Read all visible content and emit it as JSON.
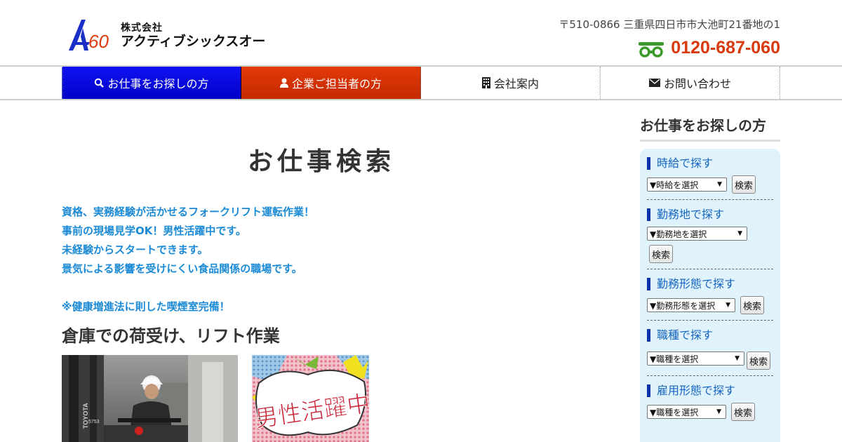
{
  "header": {
    "logo_small": "株式会社",
    "logo_big": "アクティブシックスオー",
    "address": "〒510-0866 三重県四日市市大池町21番地の1",
    "phone": "0120-687-060",
    "phone_icon": "freedial-icon",
    "colors": {
      "phone": "#d83a10",
      "logo_blue": "#1a2fc8",
      "logo_red": "#e03a10"
    }
  },
  "nav": {
    "items": [
      {
        "label": "お仕事をお探しの方",
        "icon": "search-icon",
        "color": "#0000e0"
      },
      {
        "label": "企業ご担当者の方",
        "icon": "user-icon",
        "color": "#d83a0a"
      },
      {
        "label": "会社案内",
        "icon": "building-icon"
      },
      {
        "label": "お問い合わせ",
        "icon": "envelope-icon"
      }
    ]
  },
  "main": {
    "title": "お仕事検索",
    "intro": [
      "資格、実務経験が活かせるフォークリフト運転作業！",
      "事前の現場見学OK！男性活躍中です。",
      "未経験からスタートできます。",
      "景気による影響を受けにくい食品関係の職場です。",
      "※健康増進法に則した喫煙室完備！"
    ],
    "job_title": "倉庫での荷受け、リフト作業",
    "photo1_text": "TOYOTA",
    "photo1_plate": "5753",
    "photo2_text": "男性活躍中",
    "accent_color": "#1b8ad6"
  },
  "sidebar": {
    "title": "お仕事をお探しの方",
    "groups": [
      {
        "label": "時給で探す",
        "select": "▼時給を選択",
        "button": "検索"
      },
      {
        "label": "勤務地で探す",
        "select": "▼勤務地を選択",
        "button": "検索"
      },
      {
        "label": "勤務形態で探す",
        "select": "▼勤務形態を選択",
        "button": "検索"
      },
      {
        "label": "職種で探す",
        "select": "▼職種を選択",
        "button": "検索"
      },
      {
        "label": "雇用形態で探す",
        "select": "▼職種を選択",
        "button": "検索"
      }
    ],
    "box_color": "#e0f3fc"
  }
}
